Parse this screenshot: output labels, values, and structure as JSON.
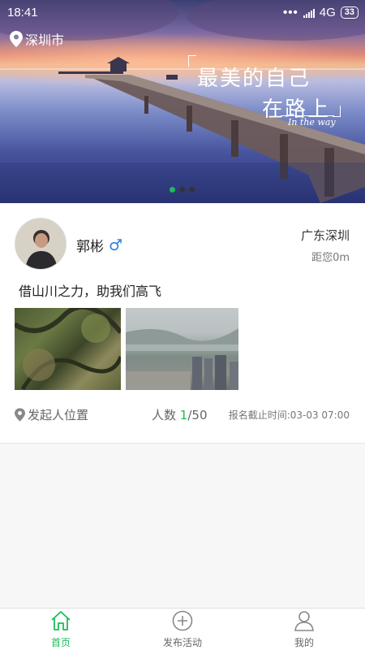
{
  "status_bar": {
    "time": "18:41",
    "network": "4G",
    "battery": "33"
  },
  "banner": {
    "city": "深圳市",
    "slogan_line1": "最美的自己",
    "slogan_line2": "在路上",
    "slogan_en": "In the way",
    "active_page": 1,
    "page_count": 3
  },
  "activity": {
    "user_name": "郭彬",
    "gender_symbol": "♂",
    "location": "广东深圳",
    "distance": "距您0m",
    "description": "借山川之力，助我们高飞",
    "initiator_label": "发起人位置",
    "count_label": "人数",
    "count_current": "1",
    "count_sep_total": "/50",
    "deadline": "报名截止时间:03-03 07:00"
  },
  "nav": {
    "home": "首页",
    "publish": "发布活动",
    "mine": "我的"
  },
  "colors": {
    "accent": "#1bbd5a",
    "male": "#2f7de1"
  }
}
